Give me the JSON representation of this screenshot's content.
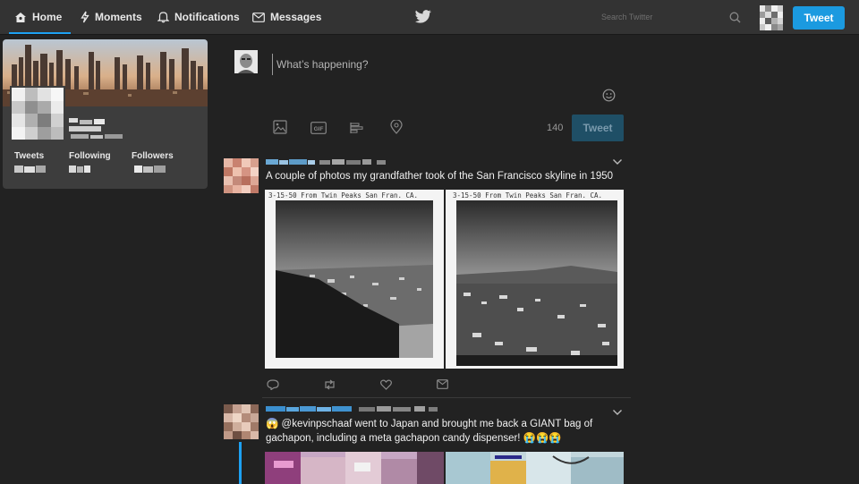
{
  "nav": {
    "home": "Home",
    "moments": "Moments",
    "notifications": "Notifications",
    "messages": "Messages"
  },
  "search": {
    "placeholder": "Search Twitter"
  },
  "header": {
    "tweet_button": "Tweet"
  },
  "profile": {
    "tweets_label": "Tweets",
    "following_label": "Following",
    "followers_label": "Followers"
  },
  "composer": {
    "placeholder": "What’s happening?",
    "char_count": "140",
    "tweet_button": "Tweet"
  },
  "tweets": [
    {
      "text": "A couple of photos my grandfather took of the San Francisco skyline in 1950",
      "photo_caption_1": "3-15-50 From Twin Peaks San Fran. CA.",
      "photo_caption_2": "3-15-50 From Twin Peaks San Fran. CA."
    },
    {
      "text": "😱 @kevinpschaaf went to Japan and brought me back a GIANT bag of gachapon, including a meta gachapon candy dispenser! 😭😭😭"
    }
  ],
  "colors": {
    "accent": "#1da1f2",
    "tweet_button": "#1b9ae0",
    "background": "#222222",
    "topbar": "#333333",
    "card": "#3d3d3d"
  },
  "icons": {
    "home": "home-icon",
    "moments": "lightning-icon",
    "notifications": "bell-icon",
    "messages": "envelope-icon",
    "logo": "twitter-bird-icon",
    "search": "search-icon",
    "emoji": "smiley-icon",
    "image": "image-icon",
    "gif": "gif-icon",
    "poll": "poll-icon",
    "location": "location-pin-icon",
    "reply": "reply-icon",
    "retweet": "retweet-icon",
    "like": "heart-icon",
    "dm": "envelope-icon",
    "chevron": "chevron-down-icon"
  }
}
